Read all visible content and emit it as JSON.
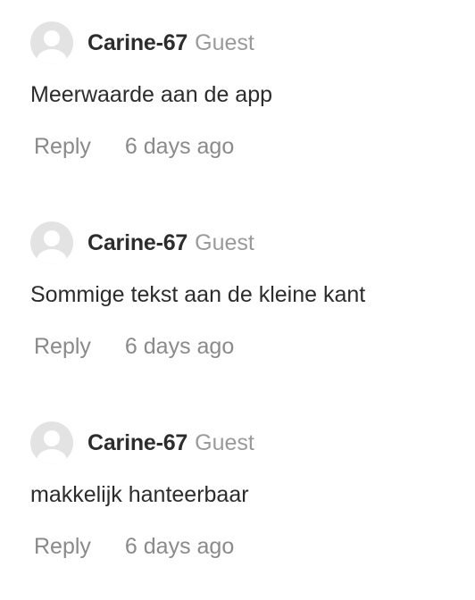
{
  "comments": [
    {
      "author": "Carine-67",
      "role": "Guest",
      "text": "Meerwaarde aan de app",
      "reply_label": "Reply",
      "timestamp": "6 days ago",
      "avatar_icon": "user-avatar-icon"
    },
    {
      "author": "Carine-67",
      "role": "Guest",
      "text": "Sommige tekst aan de kleine kant",
      "reply_label": "Reply",
      "timestamp": "6 days ago",
      "avatar_icon": "user-avatar-icon"
    },
    {
      "author": "Carine-67",
      "role": "Guest",
      "text": "makkelijk hanteerbaar",
      "reply_label": "Reply",
      "timestamp": "6 days ago",
      "avatar_icon": "user-avatar-icon"
    }
  ],
  "colors": {
    "author": "#2c2c2c",
    "muted": "#9a9a9a",
    "avatar_bg": "#e3e3e3",
    "avatar_fg": "#ffffff"
  }
}
